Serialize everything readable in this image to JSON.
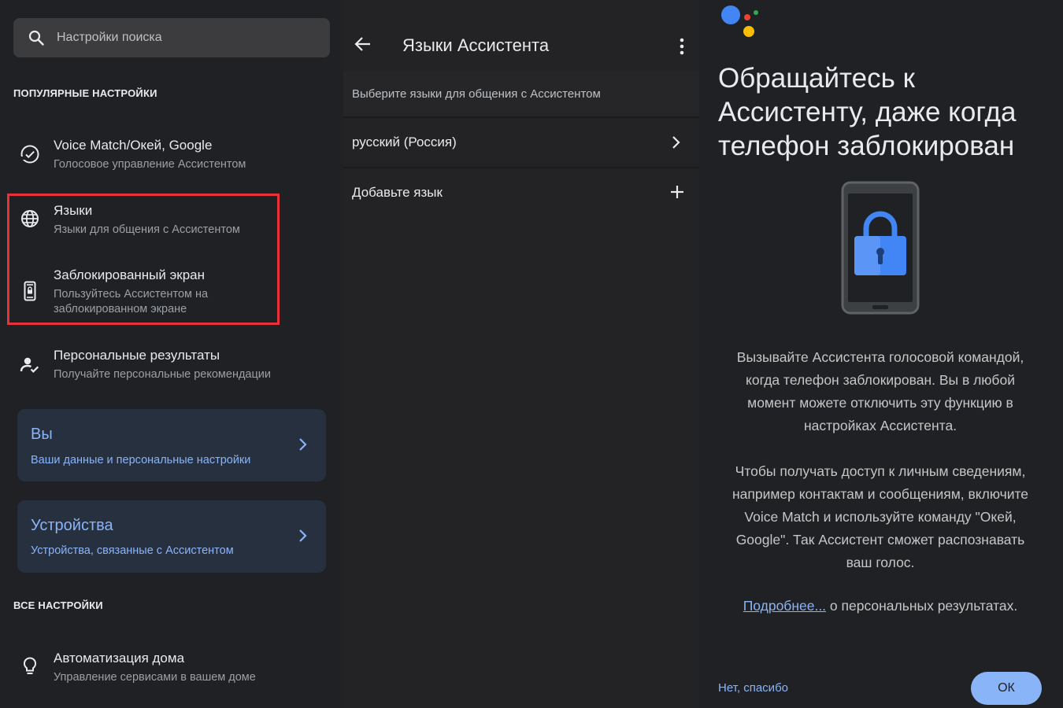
{
  "settings": {
    "search_placeholder": "Настройки поиска",
    "popular_label": "ПОПУЛЯРНЫЕ НАСТРОЙКИ",
    "all_label": "ВСЕ НАСТРОЙКИ",
    "items": [
      {
        "title": "Voice Match/Окей, Google",
        "sub": "Голосовое управление Ассистентом",
        "icon": "voice-match-icon"
      },
      {
        "title": "Языки",
        "sub": "Языки для общения с Ассистентом",
        "icon": "globe-icon"
      },
      {
        "title": "Заблокированный экран",
        "sub1": "Пользуйтесь Ассистентом на",
        "sub2": "заблокированном экране",
        "icon": "lock-screen-phone-icon"
      },
      {
        "title": "Персональные результаты",
        "sub": "Получайте персональные рекомендации",
        "icon": "person-check-icon"
      },
      {
        "title": "Автоматизация дома",
        "sub": "Управление сервисами в вашем доме",
        "icon": "lightbulb-icon"
      }
    ],
    "cards": [
      {
        "title": "Вы",
        "sub": "Ваши данные и персональные настройки"
      },
      {
        "title": "Устройства",
        "sub": "Устройства, связанные с Ассистентом"
      }
    ]
  },
  "languages": {
    "title": "Языки Ассистента",
    "description": "Выберите языки для общения с Ассистентом",
    "current_language": "русский (Россия)",
    "add_language": "Добавьте язык"
  },
  "lockscreen": {
    "title": "Обращайтесь к Ассистенту, даже когда телефон заблокирован",
    "para1_lines": [
      "Вызывайте Ассистента голосовой командой,",
      "когда телефон заблокирован. Вы в любой",
      "момент можете отключить эту функцию в",
      "настройках Ассистента."
    ],
    "para2_lines": [
      "Чтобы получать доступ к личным сведениям,",
      "например контактам и сообщениям, включите",
      "Voice Match и используйте команду \"Окей,",
      "Google\". Так Ассистент сможет распознавать",
      "ваш голос."
    ],
    "more_link": "Подробнее...",
    "more_rest": " о персональных результатах.",
    "no_thanks": "Нет, спасибо",
    "ok": "ОК"
  },
  "colors": {
    "accent": "#8ab4f8",
    "highlight_border": "#e8323a",
    "google_blue": "#4285f4",
    "google_red": "#ea4335",
    "google_yellow": "#fbbc04",
    "google_green": "#34a853"
  }
}
